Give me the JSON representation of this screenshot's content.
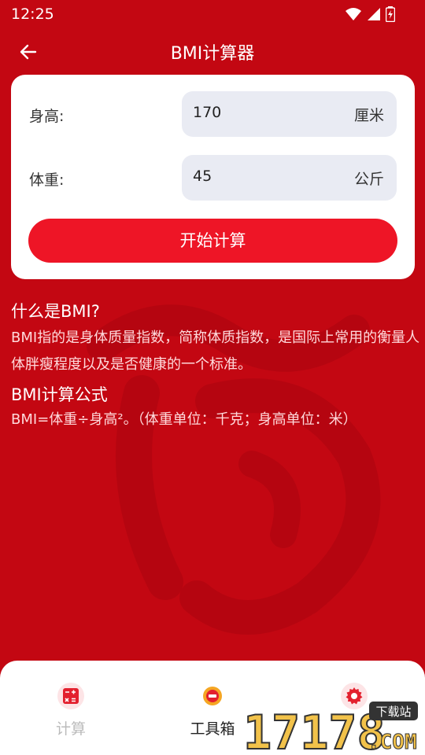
{
  "status_bar": {
    "time": "12:25"
  },
  "app_bar": {
    "title": "BMI计算器"
  },
  "form": {
    "height": {
      "label": "身高:",
      "value": "170",
      "unit": "厘米"
    },
    "weight": {
      "label": "体重:",
      "value": "45",
      "unit": "公斤"
    },
    "submit_label": "开始计算"
  },
  "info": {
    "what_title": "什么是BMI?",
    "what_text": "BMI指的是身体质量指数，简称体质指数，是国际上常用的衡量人体胖瘦程度以及是否健康的一个标准。",
    "formula_title": "BMI计算公式",
    "formula_text": "BMI=体重÷身高²。（体重单位：千克；身高单位：米）"
  },
  "bottom_nav": {
    "items": [
      {
        "label": "计算",
        "icon": "calculator-icon"
      },
      {
        "label": "工具箱",
        "icon": "toolbox-icon"
      },
      {
        "label": "",
        "icon": "gear-icon"
      }
    ]
  },
  "watermark": {
    "text": "17178",
    "tag": "下载站",
    "suffix": ".COM"
  },
  "colors": {
    "background": "#c30712",
    "accent": "#ee1526",
    "field_bg": "#e9ebf3",
    "nav_icon_bg": "#fde4e6"
  }
}
